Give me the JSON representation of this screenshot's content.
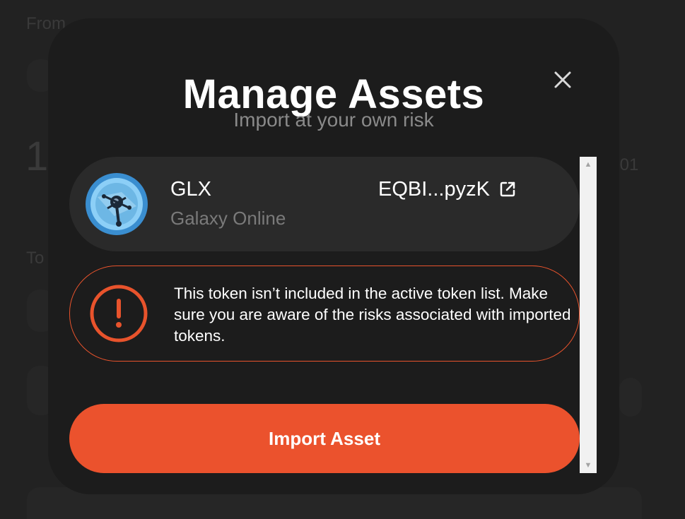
{
  "background": {
    "from_label": "From",
    "to_label": "To",
    "amount_digit": "1",
    "right_value": ".01"
  },
  "modal": {
    "title": "Manage Assets",
    "subtitle": "Import at your own risk",
    "close_icon": "close-icon"
  },
  "token": {
    "symbol": "GLX",
    "name": "Galaxy Online",
    "address": "EQBI...pyzK",
    "link_icon": "external-link-icon"
  },
  "warning": {
    "icon": "exclamation-circle-icon",
    "text": "This token isn’t included in the active token list. Make sure you are aware of the risks associated with imported tokens."
  },
  "actions": {
    "import_label": "Import Asset"
  },
  "colors": {
    "accent": "#eb522d",
    "warning_border": "#e8532c",
    "modal_bg": "#1c1c1c",
    "card_bg": "#2a2a2a"
  }
}
